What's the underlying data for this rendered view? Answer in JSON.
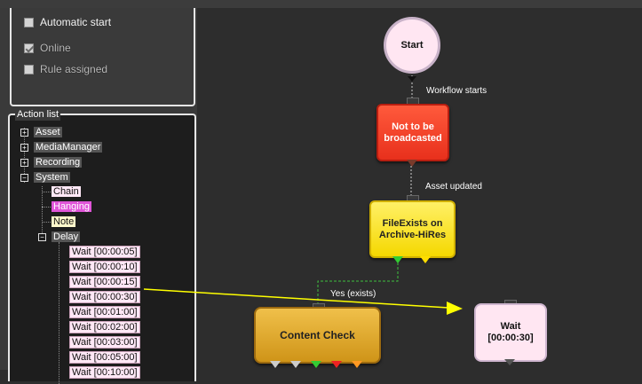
{
  "properties": {
    "automatic_start": "Automatic start",
    "online": "Online",
    "rule_assigned": "Rule assigned"
  },
  "action_list": {
    "title": "Action list",
    "categories": [
      "Asset",
      "MediaManager",
      "Recording",
      "System"
    ],
    "system_children": [
      "Chain",
      "Hanging",
      "Note",
      "Delay"
    ],
    "delay_children": [
      "Wait [00:00:05]",
      "Wait [00:00:10]",
      "Wait [00:00:15]",
      "Wait [00:00:30]",
      "Wait [00:01:00]",
      "Wait [00:02:00]",
      "Wait [00:03:00]",
      "Wait [00:05:00]",
      "Wait [00:10:00]"
    ]
  },
  "workflow": {
    "start": "Start",
    "edge_workflow_starts": "Workflow starts",
    "not_broadcasted": "Not to be broadcasted",
    "edge_asset_updated": "Asset updated",
    "file_exists": "FileExists on Archive-HiRes",
    "edge_yes_exists": "Yes (exists)",
    "content_check": "Content Check",
    "wait_node": "Wait [00:00:30]"
  },
  "colors": {
    "drag_arrow": "#ffff00",
    "port_green": "#33cc33",
    "port_yellow": "#ffdd00",
    "port_red": "#ee2222",
    "port_orange": "#ff9922",
    "port_gray": "#cccccc"
  }
}
